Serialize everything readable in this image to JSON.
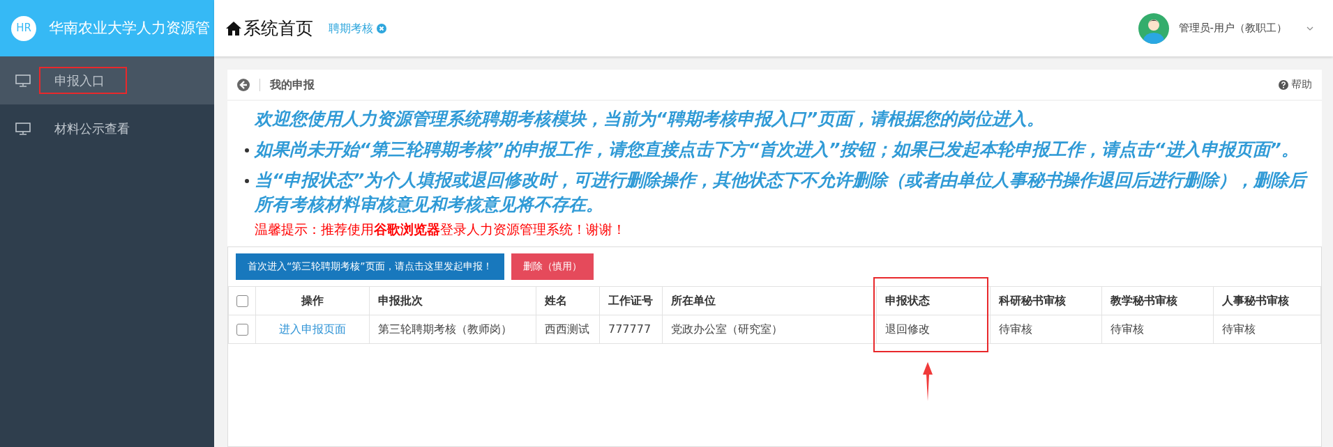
{
  "brand": {
    "logo": "HR",
    "title": "华南农业大学人力资源管"
  },
  "sidebar": {
    "items": [
      {
        "label": "申报入口",
        "selected": true,
        "highlighted": true
      },
      {
        "label": "材料公示查看",
        "selected": false,
        "highlighted": false
      }
    ]
  },
  "header": {
    "home_label": "系统首页",
    "tabs": [
      {
        "label": "聘期考核",
        "selected": true
      }
    ],
    "user": "管理员-用户（教职工）"
  },
  "breadcrumb": {
    "title": "我的申报",
    "help": "帮助"
  },
  "notice": {
    "intro": "欢迎您使用人力资源管理系统聘期考核模块，当前为“聘期考核申报入口”页面，请根据您的岗位进入。",
    "bullets": [
      "如果尚未开始“第三轮聘期考核”的申报工作，请您直接点击下方“首次进入”按钮；如果已发起本轮申报工作，请点击“进入申报页面”。",
      "当“申报状态”为个人填报或退回修改时，可进行删除操作，其他状态下不允许删除（或者由单位人事秘书操作退回后进行删除），删除后所有考核材料审核意见和考核意见将不存在。"
    ],
    "tip": "温馨提示：推荐使用**谷歌浏览器**登录人力资源管理系统！谢谢！"
  },
  "buttons": [
    {
      "label": "首次进入“第三轮聘期考核”页面，请点击这里发起申报！",
      "kind": "primary"
    },
    {
      "label": "删除（慎用）",
      "kind": "danger"
    }
  ],
  "table": {
    "columns": [
      {
        "kind": "checkbox",
        "checked": false,
        "highlighted": false
      },
      {
        "kind": "text",
        "label": "操作",
        "highlighted": false
      },
      {
        "kind": "text",
        "label": "申报批次",
        "highlighted": false
      },
      {
        "kind": "text",
        "label": "姓名",
        "highlighted": false
      },
      {
        "kind": "text",
        "label": "工作证号",
        "highlighted": false
      },
      {
        "kind": "text",
        "label": "所在单位",
        "highlighted": false
      },
      {
        "kind": "text",
        "label": "申报状态",
        "highlighted": true
      },
      {
        "kind": "text",
        "label": "科研秘书审核",
        "highlighted": false
      },
      {
        "kind": "text",
        "label": "教学秘书审核",
        "highlighted": false
      },
      {
        "kind": "text",
        "label": "人事秘书审核",
        "highlighted": false
      }
    ],
    "rows": [
      {
        "cells": [
          {
            "kind": "checkbox",
            "checked": false
          },
          {
            "kind": "link",
            "text": "进入申报页面"
          },
          {
            "kind": "text",
            "text": "第三轮聘期考核（教师岗）"
          },
          {
            "kind": "text",
            "text": "西西测试"
          },
          {
            "kind": "text",
            "text": "777777"
          },
          {
            "kind": "text",
            "text": "党政办公室（研究室）"
          },
          {
            "kind": "text",
            "text": "退回修改"
          },
          {
            "kind": "text",
            "text": "待审核"
          },
          {
            "kind": "text",
            "text": "待审核"
          },
          {
            "kind": "text",
            "text": "待审核"
          }
        ]
      }
    ]
  }
}
